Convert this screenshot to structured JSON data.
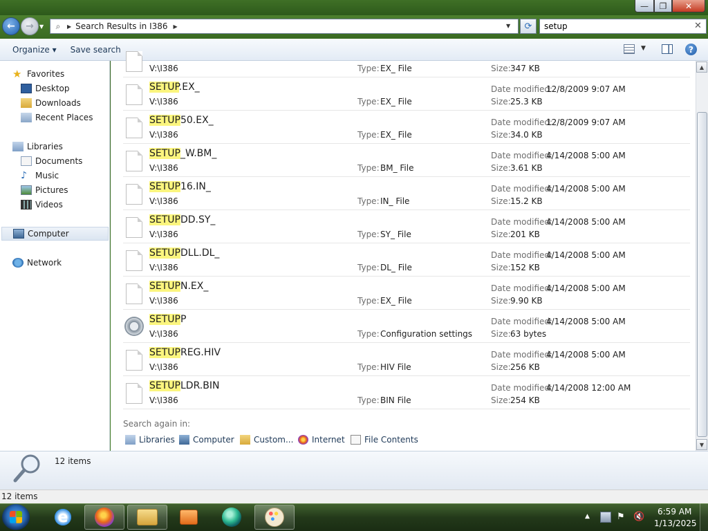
{
  "window": {
    "min_glyph": "—",
    "max_glyph": "❐",
    "close_glyph": "✕"
  },
  "address": {
    "crumb": "Search Results in I386"
  },
  "search": {
    "value": "setup"
  },
  "toolbar": {
    "organize": "Organize ▾",
    "save_search": "Save search"
  },
  "nav": {
    "favorites": "Favorites",
    "desktop": "Desktop",
    "downloads": "Downloads",
    "recent": "Recent Places",
    "libraries": "Libraries",
    "documents": "Documents",
    "music": "Music",
    "pictures": "Pictures",
    "videos": "Videos",
    "computer": "Computer",
    "network": "Network"
  },
  "labels": {
    "type": "Type:",
    "date": "Date modified:",
    "size": "Size:"
  },
  "results": [
    {
      "hl": "",
      "rest": "",
      "path": "V:\\I386",
      "type": "EX_ File",
      "date": "",
      "size": "347 KB",
      "icon": "file-icon"
    },
    {
      "hl": "SETUP",
      "rest": ".EX_",
      "path": "V:\\I386",
      "type": "EX_ File",
      "date": "12/8/2009 9:07 AM",
      "size": "25.3 KB",
      "icon": "file-icon"
    },
    {
      "hl": "SETUP",
      "rest": "50.EX_",
      "path": "V:\\I386",
      "type": "EX_ File",
      "date": "12/8/2009 9:07 AM",
      "size": "34.0 KB",
      "icon": "file-icon"
    },
    {
      "hl": "SETUP",
      "rest": "_W.BM_",
      "path": "V:\\I386",
      "type": "BM_ File",
      "date": "4/14/2008 5:00 AM",
      "size": "3.61 KB",
      "icon": "file-icon"
    },
    {
      "hl": "SETUP",
      "rest": "16.IN_",
      "path": "V:\\I386",
      "type": "IN_ File",
      "date": "4/14/2008 5:00 AM",
      "size": "15.2 KB",
      "icon": "file-icon"
    },
    {
      "hl": "SETUP",
      "rest": "DD.SY_",
      "path": "V:\\I386",
      "type": "SY_ File",
      "date": "4/14/2008 5:00 AM",
      "size": "201 KB",
      "icon": "file-icon"
    },
    {
      "hl": "SETUP",
      "rest": "DLL.DL_",
      "path": "V:\\I386",
      "type": "DL_ File",
      "date": "4/14/2008 5:00 AM",
      "size": "152 KB",
      "icon": "file-icon"
    },
    {
      "hl": "SETUP",
      "rest": "N.EX_",
      "path": "V:\\I386",
      "type": "EX_ File",
      "date": "4/14/2008 5:00 AM",
      "size": "9.90 KB",
      "icon": "file-icon"
    },
    {
      "hl": "SETUP",
      "rest": "P",
      "path": "V:\\I386",
      "type": "Configuration settings",
      "date": "4/14/2008 5:00 AM",
      "size": "63 bytes",
      "icon": "config-icon"
    },
    {
      "hl": "SETUP",
      "rest": "REG.HIV",
      "path": "V:\\I386",
      "type": "HIV File",
      "date": "4/14/2008 5:00 AM",
      "size": "256 KB",
      "icon": "file-icon"
    },
    {
      "hl": "SETUP",
      "rest": "LDR.BIN",
      "path": "V:\\I386",
      "type": "BIN File",
      "date": "4/14/2008 12:00 AM",
      "size": "254 KB",
      "icon": "file-icon"
    }
  ],
  "search_again": {
    "label": "Search again in:",
    "libraries": "Libraries",
    "computer": "Computer",
    "custom": "Custom...",
    "internet": "Internet",
    "file_contents": "File Contents"
  },
  "details": {
    "count": "12 items"
  },
  "status": {
    "text": "12 items"
  },
  "clock": {
    "time": "6:59 AM",
    "date": "1/13/2025"
  },
  "colors": {
    "highlight": "#fbf57e",
    "accent": "#1c5aa8"
  }
}
